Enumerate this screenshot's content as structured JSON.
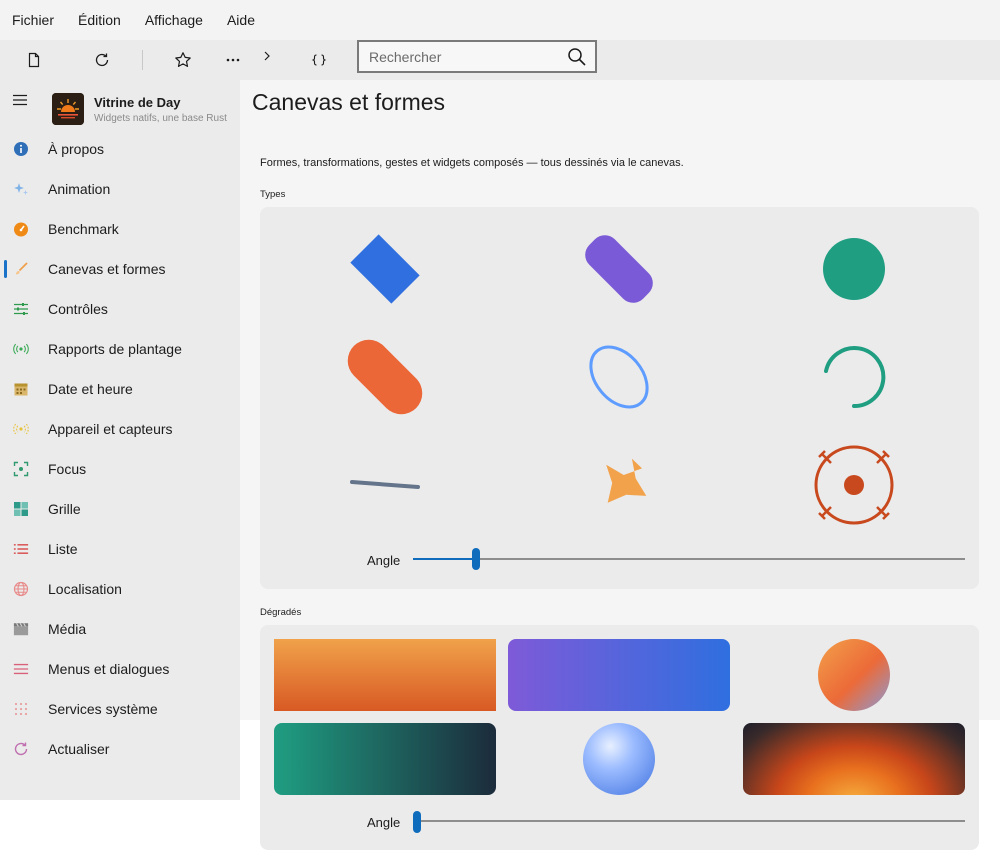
{
  "menubar": {
    "items": [
      "Fichier",
      "Édition",
      "Affichage",
      "Aide"
    ]
  },
  "toolbar": {
    "buttons": [
      "new-page-icon",
      "refresh-icon",
      "star-icon",
      "more-icon",
      "chevron-right-icon",
      "braces-icon"
    ],
    "search": {
      "placeholder": "Rechercher",
      "value": ""
    }
  },
  "sidebar": {
    "app_title": "Vitrine de Day",
    "app_subtitle": "Widgets natifs, une base Rust",
    "items": [
      {
        "label": "À propos",
        "icon": "info-icon",
        "color": "#2f6fb8"
      },
      {
        "label": "Animation",
        "icon": "sparkle-icon",
        "color": "#7fb3e8"
      },
      {
        "label": "Benchmark",
        "icon": "gauge-icon",
        "color": "#ef8a17"
      },
      {
        "label": "Canevas et formes",
        "icon": "brush-icon",
        "color": "#f0a04b",
        "active": true
      },
      {
        "label": "Contrôles",
        "icon": "sliders-icon",
        "color": "#2e9a4e"
      },
      {
        "label": "Rapports de plantage",
        "icon": "broadcast-icon",
        "color": "#3aaa55"
      },
      {
        "label": "Date et heure",
        "icon": "calendar-icon",
        "color": "#b8922e"
      },
      {
        "label": "Appareil et capteurs",
        "icon": "sensor-icon",
        "color": "#e8c23a"
      },
      {
        "label": "Focus",
        "icon": "focus-icon",
        "color": "#2e9a6e"
      },
      {
        "label": "Grille",
        "icon": "grid-icon",
        "color": "#2e9a8a"
      },
      {
        "label": "Liste",
        "icon": "list-icon",
        "color": "#d94a4a"
      },
      {
        "label": "Localisation",
        "icon": "globe-icon",
        "color": "#e88a8a"
      },
      {
        "label": "Média",
        "icon": "clapper-icon",
        "color": "#8a8a8a"
      },
      {
        "label": "Menus et dialogues",
        "icon": "menu-icon",
        "color": "#d9607a"
      },
      {
        "label": "Services système",
        "icon": "dots-grid-icon",
        "color": "#e8a0a0"
      },
      {
        "label": "Actualiser",
        "icon": "refresh-icon",
        "color": "#c070b0"
      }
    ]
  },
  "main": {
    "title": "Canevas et formes",
    "description": "Formes, transformations, gestes et widgets composés — tous dessinés via le canevas.",
    "types_label": "Types",
    "types_slider": {
      "label": "Angle",
      "value": 0.1
    },
    "gradients_label": "Dégradés",
    "gradients_slider": {
      "label": "Angle",
      "value": 0.0
    },
    "colors": {
      "blue": "#2f6fdf",
      "purple": "#7a5ad6",
      "teal": "#1f9e82",
      "orange": "#ec6738",
      "ring_blue": "#5e9cff",
      "slate": "#64748b",
      "star": "#f2a24a",
      "target": "#c9491e",
      "accent": "#0f6cbd"
    }
  }
}
